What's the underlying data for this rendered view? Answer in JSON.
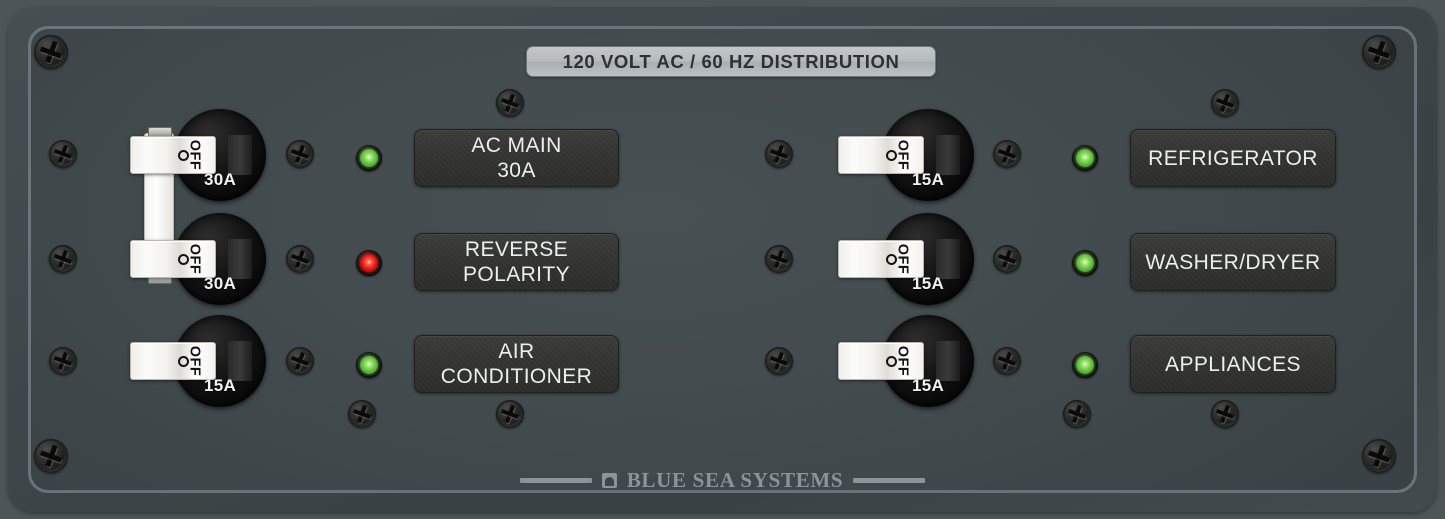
{
  "panel": {
    "title": "120 VOLT AC / 60 HZ DISTRIBUTION",
    "brand": "BLUE SEA SYSTEMS",
    "colors": {
      "panel_face": "#414a4d",
      "title_plate": "#b6bbbd",
      "label_plate": "#333331",
      "led_green": "#5dbb3a",
      "led_red": "#e01010",
      "brand_text": "#8b9499"
    }
  },
  "toggle": {
    "position_text": "OFF",
    "position_symbol": "O"
  },
  "circuits": {
    "left": [
      {
        "breaker_rating": "30A",
        "toggle_state": "OFF",
        "indicator_color": "green",
        "label_line1": "AC MAIN",
        "label_line2": "30A",
        "ganged": true
      },
      {
        "breaker_rating": "30A",
        "toggle_state": "OFF",
        "indicator_color": "red",
        "label_line1": "REVERSE",
        "label_line2": "POLARITY",
        "ganged": true
      },
      {
        "breaker_rating": "15A",
        "toggle_state": "OFF",
        "indicator_color": "green",
        "label_line1": "AIR",
        "label_line2": "CONDITIONER",
        "ganged": false
      }
    ],
    "right": [
      {
        "breaker_rating": "15A",
        "toggle_state": "OFF",
        "indicator_color": "green",
        "label_line1": "REFRIGERATOR",
        "label_line2": "",
        "ganged": false
      },
      {
        "breaker_rating": "15A",
        "toggle_state": "OFF",
        "indicator_color": "green",
        "label_line1": "WASHER/DRYER",
        "label_line2": "",
        "ganged": false
      },
      {
        "breaker_rating": "15A",
        "toggle_state": "OFF",
        "indicator_color": "green",
        "label_line1": "APPLIANCES",
        "label_line2": "",
        "ganged": false
      }
    ]
  }
}
